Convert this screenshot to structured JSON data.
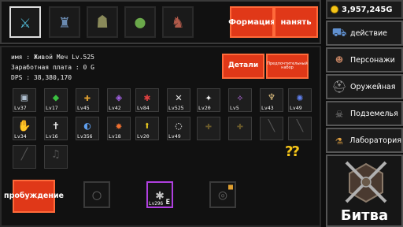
{
  "party": {
    "heroes": [
      {
        "name": "crystal-sword-hero",
        "icon": "crystal-sword-icon",
        "glyph": "⚔",
        "color": "#5ad0f0",
        "selected": true
      },
      {
        "name": "stone-golem-hero",
        "icon": "golem-icon",
        "glyph": "♜",
        "color": "#6a8ab0",
        "selected": false
      },
      {
        "name": "goblin-warrior-hero",
        "icon": "goblin-icon",
        "glyph": "☗",
        "color": "#8a8a5a",
        "selected": false
      },
      {
        "name": "green-slime-hero",
        "icon": "slime-icon",
        "glyph": "●",
        "color": "#6aa84a",
        "selected": false
      },
      {
        "name": "demon-knight-hero",
        "icon": "demon-icon",
        "glyph": "♞",
        "color": "#b05a4a",
        "selected": false
      }
    ],
    "formation_label": "Формация",
    "hire_label": "нанять"
  },
  "info": {
    "name_line": "имя : Живой Меч Lv.525",
    "salary_line": "Заработная плата : 0 G",
    "dps_line": "DPS : 38,380,170",
    "details_label": "Детали",
    "preferred_label": "Предпочтительный набор"
  },
  "equipment": [
    {
      "name": "armor-slot",
      "icon": "armor-icon",
      "glyph": "▣",
      "color": "#b0c0d0",
      "level": "Lv37"
    },
    {
      "name": "green-blade-slot",
      "icon": "green-blade-icon",
      "glyph": "◆",
      "color": "#3ac040",
      "level": "Lv17"
    },
    {
      "name": "golden-axe-slot",
      "icon": "axe-icon",
      "glyph": "✚",
      "color": "#e0a030",
      "level": "Lv45"
    },
    {
      "name": "purple-gem-slot",
      "icon": "gem-icon",
      "glyph": "◈",
      "color": "#a060e0",
      "level": "Lv42"
    },
    {
      "name": "red-claw-slot",
      "icon": "claw-icon",
      "glyph": "✱",
      "color": "#e04040",
      "level": "Lv84"
    },
    {
      "name": "crossed-swords-slot",
      "icon": "crossed-swords-icon",
      "glyph": "✕",
      "color": "#e0e0e0",
      "level": "Lv525"
    },
    {
      "name": "star-wand-slot",
      "icon": "star-wand-icon",
      "glyph": "✦",
      "color": "#f0f0f0",
      "level": "Lv20"
    },
    {
      "name": "violet-staff-slot",
      "icon": "staff-icon",
      "glyph": "✧",
      "color": "#c070f0",
      "level": "Lv5"
    },
    {
      "name": "lamp-slot",
      "icon": "lamp-icon",
      "glyph": "♆",
      "color": "#e0c080",
      "level": "Lv43"
    },
    {
      "name": "blue-orb-slot",
      "icon": "orb-icon",
      "glyph": "✺",
      "color": "#6080f0",
      "level": "Lv49"
    },
    {
      "name": "gauntlet-slot",
      "icon": "gauntlet-icon",
      "glyph": "✋",
      "color": "#d0b070",
      "level": "Lv34"
    },
    {
      "name": "tooth-slot",
      "icon": "tooth-icon",
      "glyph": "✝",
      "color": "#f0f0f0",
      "level": "Lv16"
    },
    {
      "name": "shield-slot",
      "icon": "shield-icon",
      "glyph": "◐",
      "color": "#60a0f0",
      "level": "Lv356"
    },
    {
      "name": "fire-fist-slot",
      "icon": "fire-fist-icon",
      "glyph": "✸",
      "color": "#f07030",
      "level": "Lv18"
    },
    {
      "name": "up-arrow-slot",
      "icon": "up-arrow-icon",
      "glyph": "⬆",
      "color": "#f0d020",
      "level": "Lv20"
    },
    {
      "name": "whip-slot",
      "icon": "whip-icon",
      "glyph": "◌",
      "color": "#e0e0e0",
      "level": "Lv49"
    },
    {
      "name": "locked-shirt-slot",
      "icon": "shirt-icon",
      "glyph": "✚",
      "color": "#6a5a2a",
      "level": ""
    },
    {
      "name": "locked-vest-slot",
      "icon": "vest-icon",
      "glyph": "✚",
      "color": "#6a5a2a",
      "level": ""
    },
    {
      "name": "locked-bow-slot",
      "icon": "bow-icon",
      "glyph": "╲",
      "color": "#555555",
      "level": ""
    },
    {
      "name": "locked-spear-slot",
      "icon": "spear-icon",
      "glyph": "╲",
      "color": "#555555",
      "level": ""
    },
    {
      "name": "locked-scythe-slot",
      "icon": "scythe-icon",
      "glyph": "╱",
      "color": "#555555",
      "level": ""
    },
    {
      "name": "locked-note-slot",
      "icon": "music-note-icon",
      "glyph": "♫",
      "color": "#555555",
      "level": ""
    }
  ],
  "bottom": {
    "awaken_label": "пробуждение",
    "rune_level": "Lv296",
    "rune_letter": "E"
  },
  "sidebar": {
    "gold": "3,957,245G",
    "items": [
      {
        "name": "action",
        "icon": "caravan-icon",
        "glyph": "⛟",
        "color": "#6090d0",
        "label": "действие"
      },
      {
        "name": "characters",
        "icon": "character-icon",
        "glyph": "☻",
        "color": "#c08060",
        "label": "Персонажи"
      },
      {
        "name": "armory",
        "icon": "helmet-icon",
        "glyph": "⛑",
        "color": "#a0a0a0",
        "label": "Оружейная"
      },
      {
        "name": "dungeon",
        "icon": "dungeon-icon",
        "glyph": "☠",
        "color": "#8a8a8a",
        "label": "Подземелья"
      },
      {
        "name": "laboratory",
        "icon": "flask-icon",
        "glyph": "⚗",
        "color": "#e0a040",
        "label": "Лаборатория"
      }
    ],
    "battle_label": "Битва"
  }
}
